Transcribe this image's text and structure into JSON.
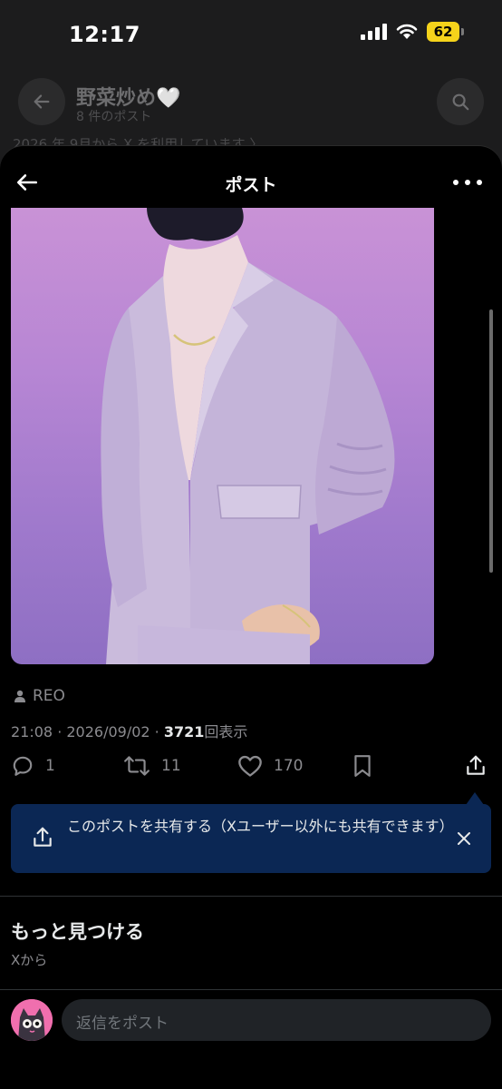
{
  "status": {
    "time": "12:17",
    "battery": "62",
    "signal_icon": "cellular-signal-icon",
    "wifi_icon": "wifi-icon"
  },
  "background_profile": {
    "name": "野菜炒め🤍",
    "post_count": "8 件のポスト",
    "joined": "2026 年 9月から X を利用しています 〉"
  },
  "sheet": {
    "title": "ポスト",
    "back_icon": "arrow-left-icon",
    "more_icon": "more-horizontal-icon"
  },
  "post": {
    "image_alt": "Person in lavender jacket on purple background",
    "author_label": "REO",
    "time": "21:08",
    "date": "2026/09/02",
    "views": "3721",
    "views_suffix": "回表示"
  },
  "actions": {
    "replies": "1",
    "reposts": "11",
    "likes": "170"
  },
  "share_tooltip": {
    "text": "このポストを共有する（Xユーザー以外にも共有できます）"
  },
  "discover": {
    "title": "もっと見つける",
    "subtitle": "Xから"
  },
  "reply": {
    "placeholder": "返信をポスト"
  },
  "colors": {
    "tooltip_bg": "#0b2754",
    "battery": "#f5d31b",
    "photo_bg": "#b786d4"
  }
}
